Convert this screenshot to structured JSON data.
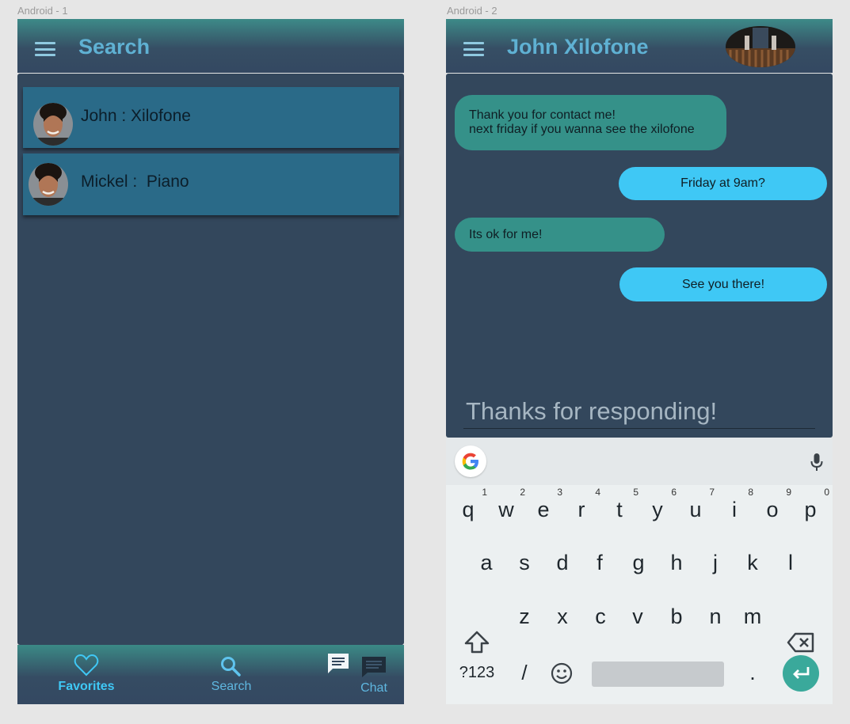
{
  "frames": {
    "left_label": "Android - 1",
    "right_label": "Android - 2"
  },
  "search_screen": {
    "title": "Search",
    "contacts": [
      {
        "name": "John : Xilofone"
      },
      {
        "name": "Mickel :  Piano"
      }
    ],
    "nav": {
      "favorites": "Favorites",
      "search": "Search",
      "chat": "Chat"
    },
    "colors": {
      "active_nav": "#3fc8f5",
      "nav_text": "#5fb7e0"
    }
  },
  "chat_screen": {
    "title": "John Xilofone",
    "messages": [
      {
        "direction": "in",
        "lines": [
          "Thank you for contact me!",
          "next friday if you wanna see the xilofone"
        ]
      },
      {
        "direction": "out",
        "lines": [
          "Friday at 9am?"
        ]
      },
      {
        "direction": "in",
        "lines": [
          "Its ok for me!"
        ]
      },
      {
        "direction": "out",
        "lines": [
          "See you there!"
        ]
      }
    ],
    "compose_text": "Thanks for responding!"
  },
  "keyboard": {
    "row1": [
      {
        "k": "q",
        "n": "1"
      },
      {
        "k": "w",
        "n": "2"
      },
      {
        "k": "e",
        "n": "3"
      },
      {
        "k": "r",
        "n": "4"
      },
      {
        "k": "t",
        "n": "5"
      },
      {
        "k": "y",
        "n": "6"
      },
      {
        "k": "u",
        "n": "7"
      },
      {
        "k": "i",
        "n": "8"
      },
      {
        "k": "o",
        "n": "9"
      },
      {
        "k": "p",
        "n": "0"
      }
    ],
    "row2": [
      "a",
      "s",
      "d",
      "f",
      "g",
      "h",
      "j",
      "k",
      "l"
    ],
    "row3": [
      "z",
      "x",
      "c",
      "v",
      "b",
      "n",
      "m"
    ],
    "symbols_key": "?123",
    "slash_key": "/",
    "period_key": "."
  }
}
